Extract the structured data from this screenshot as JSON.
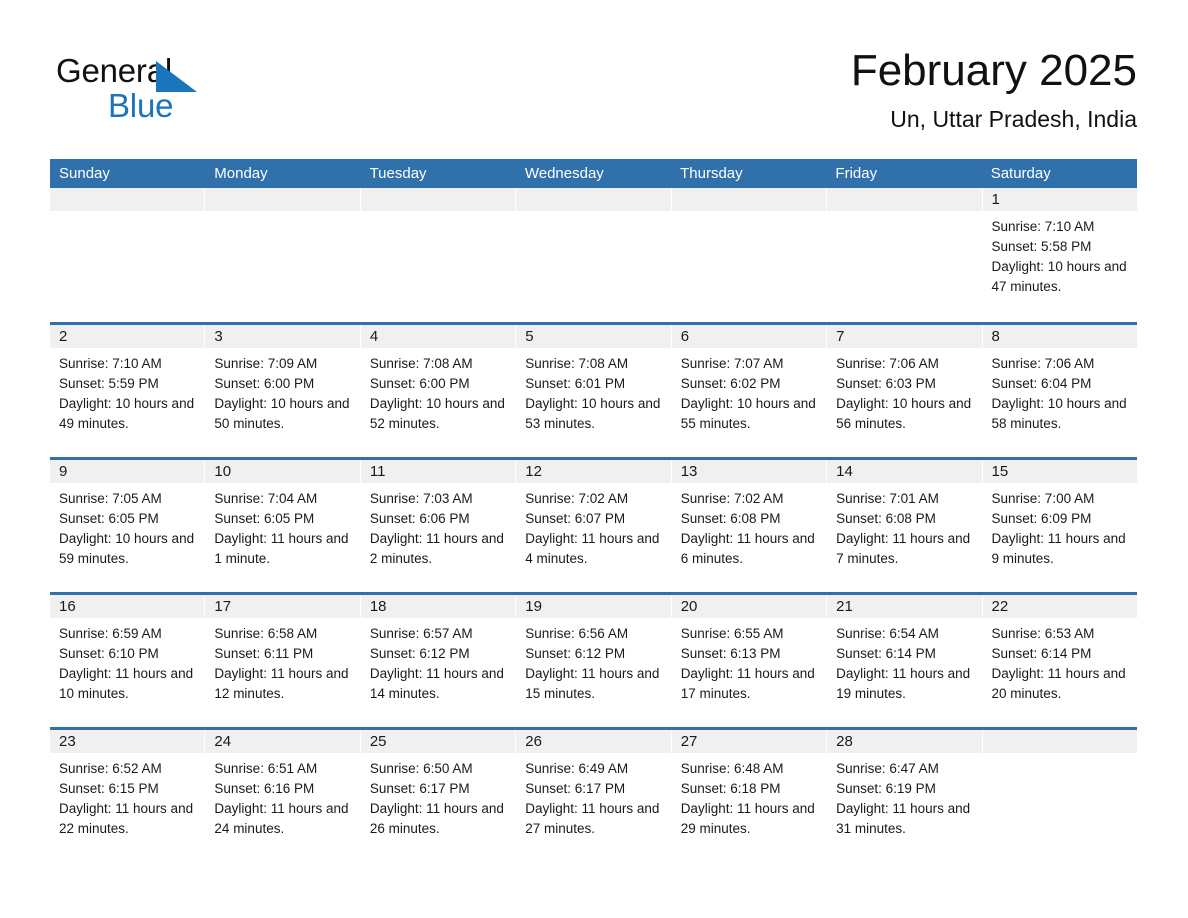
{
  "brand": {
    "name_part1": "General",
    "name_part2": "Blue",
    "logo_icon": "triangle-flag-icon"
  },
  "header": {
    "title": "February 2025",
    "subtitle": "Un, Uttar Pradesh, India"
  },
  "colors": {
    "header_blue": "#3071ac",
    "logo_blue": "#1b75bb",
    "day_band_gray": "#f0f0f0",
    "text": "#1a1a1a"
  },
  "weekdays": [
    "Sunday",
    "Monday",
    "Tuesday",
    "Wednesday",
    "Thursday",
    "Friday",
    "Saturday"
  ],
  "weeks": [
    [
      {
        "day": "",
        "sunrise": "",
        "sunset": "",
        "daylight": ""
      },
      {
        "day": "",
        "sunrise": "",
        "sunset": "",
        "daylight": ""
      },
      {
        "day": "",
        "sunrise": "",
        "sunset": "",
        "daylight": ""
      },
      {
        "day": "",
        "sunrise": "",
        "sunset": "",
        "daylight": ""
      },
      {
        "day": "",
        "sunrise": "",
        "sunset": "",
        "daylight": ""
      },
      {
        "day": "",
        "sunrise": "",
        "sunset": "",
        "daylight": ""
      },
      {
        "day": "1",
        "sunrise": "Sunrise: 7:10 AM",
        "sunset": "Sunset: 5:58 PM",
        "daylight": "Daylight: 10 hours and 47 minutes."
      }
    ],
    [
      {
        "day": "2",
        "sunrise": "Sunrise: 7:10 AM",
        "sunset": "Sunset: 5:59 PM",
        "daylight": "Daylight: 10 hours and 49 minutes."
      },
      {
        "day": "3",
        "sunrise": "Sunrise: 7:09 AM",
        "sunset": "Sunset: 6:00 PM",
        "daylight": "Daylight: 10 hours and 50 minutes."
      },
      {
        "day": "4",
        "sunrise": "Sunrise: 7:08 AM",
        "sunset": "Sunset: 6:00 PM",
        "daylight": "Daylight: 10 hours and 52 minutes."
      },
      {
        "day": "5",
        "sunrise": "Sunrise: 7:08 AM",
        "sunset": "Sunset: 6:01 PM",
        "daylight": "Daylight: 10 hours and 53 minutes."
      },
      {
        "day": "6",
        "sunrise": "Sunrise: 7:07 AM",
        "sunset": "Sunset: 6:02 PM",
        "daylight": "Daylight: 10 hours and 55 minutes."
      },
      {
        "day": "7",
        "sunrise": "Sunrise: 7:06 AM",
        "sunset": "Sunset: 6:03 PM",
        "daylight": "Daylight: 10 hours and 56 minutes."
      },
      {
        "day": "8",
        "sunrise": "Sunrise: 7:06 AM",
        "sunset": "Sunset: 6:04 PM",
        "daylight": "Daylight: 10 hours and 58 minutes."
      }
    ],
    [
      {
        "day": "9",
        "sunrise": "Sunrise: 7:05 AM",
        "sunset": "Sunset: 6:05 PM",
        "daylight": "Daylight: 10 hours and 59 minutes."
      },
      {
        "day": "10",
        "sunrise": "Sunrise: 7:04 AM",
        "sunset": "Sunset: 6:05 PM",
        "daylight": "Daylight: 11 hours and 1 minute."
      },
      {
        "day": "11",
        "sunrise": "Sunrise: 7:03 AM",
        "sunset": "Sunset: 6:06 PM",
        "daylight": "Daylight: 11 hours and 2 minutes."
      },
      {
        "day": "12",
        "sunrise": "Sunrise: 7:02 AM",
        "sunset": "Sunset: 6:07 PM",
        "daylight": "Daylight: 11 hours and 4 minutes."
      },
      {
        "day": "13",
        "sunrise": "Sunrise: 7:02 AM",
        "sunset": "Sunset: 6:08 PM",
        "daylight": "Daylight: 11 hours and 6 minutes."
      },
      {
        "day": "14",
        "sunrise": "Sunrise: 7:01 AM",
        "sunset": "Sunset: 6:08 PM",
        "daylight": "Daylight: 11 hours and 7 minutes."
      },
      {
        "day": "15",
        "sunrise": "Sunrise: 7:00 AM",
        "sunset": "Sunset: 6:09 PM",
        "daylight": "Daylight: 11 hours and 9 minutes."
      }
    ],
    [
      {
        "day": "16",
        "sunrise": "Sunrise: 6:59 AM",
        "sunset": "Sunset: 6:10 PM",
        "daylight": "Daylight: 11 hours and 10 minutes."
      },
      {
        "day": "17",
        "sunrise": "Sunrise: 6:58 AM",
        "sunset": "Sunset: 6:11 PM",
        "daylight": "Daylight: 11 hours and 12 minutes."
      },
      {
        "day": "18",
        "sunrise": "Sunrise: 6:57 AM",
        "sunset": "Sunset: 6:12 PM",
        "daylight": "Daylight: 11 hours and 14 minutes."
      },
      {
        "day": "19",
        "sunrise": "Sunrise: 6:56 AM",
        "sunset": "Sunset: 6:12 PM",
        "daylight": "Daylight: 11 hours and 15 minutes."
      },
      {
        "day": "20",
        "sunrise": "Sunrise: 6:55 AM",
        "sunset": "Sunset: 6:13 PM",
        "daylight": "Daylight: 11 hours and 17 minutes."
      },
      {
        "day": "21",
        "sunrise": "Sunrise: 6:54 AM",
        "sunset": "Sunset: 6:14 PM",
        "daylight": "Daylight: 11 hours and 19 minutes."
      },
      {
        "day": "22",
        "sunrise": "Sunrise: 6:53 AM",
        "sunset": "Sunset: 6:14 PM",
        "daylight": "Daylight: 11 hours and 20 minutes."
      }
    ],
    [
      {
        "day": "23",
        "sunrise": "Sunrise: 6:52 AM",
        "sunset": "Sunset: 6:15 PM",
        "daylight": "Daylight: 11 hours and 22 minutes."
      },
      {
        "day": "24",
        "sunrise": "Sunrise: 6:51 AM",
        "sunset": "Sunset: 6:16 PM",
        "daylight": "Daylight: 11 hours and 24 minutes."
      },
      {
        "day": "25",
        "sunrise": "Sunrise: 6:50 AM",
        "sunset": "Sunset: 6:17 PM",
        "daylight": "Daylight: 11 hours and 26 minutes."
      },
      {
        "day": "26",
        "sunrise": "Sunrise: 6:49 AM",
        "sunset": "Sunset: 6:17 PM",
        "daylight": "Daylight: 11 hours and 27 minutes."
      },
      {
        "day": "27",
        "sunrise": "Sunrise: 6:48 AM",
        "sunset": "Sunset: 6:18 PM",
        "daylight": "Daylight: 11 hours and 29 minutes."
      },
      {
        "day": "28",
        "sunrise": "Sunrise: 6:47 AM",
        "sunset": "Sunset: 6:19 PM",
        "daylight": "Daylight: 11 hours and 31 minutes."
      },
      {
        "day": "",
        "sunrise": "",
        "sunset": "",
        "daylight": ""
      }
    ]
  ]
}
